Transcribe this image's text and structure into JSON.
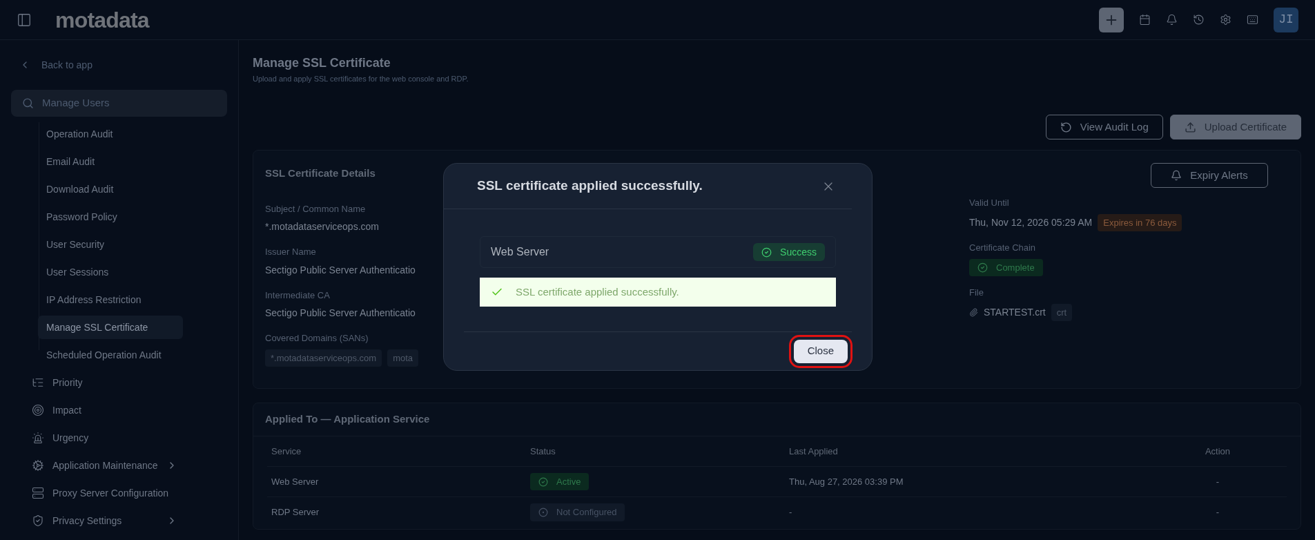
{
  "header": {
    "logo": "motadata",
    "avatar": "JI"
  },
  "sidebar": {
    "back": "Back to app",
    "search": {
      "value": "Manage Users"
    },
    "items": [
      {
        "label": "Operation Audit",
        "kind": "sub",
        "selected": false
      },
      {
        "label": "Email Audit",
        "kind": "sub",
        "selected": false
      },
      {
        "label": "Download Audit",
        "kind": "sub",
        "selected": false
      },
      {
        "label": "Password Policy",
        "kind": "sub",
        "selected": false
      },
      {
        "label": "User Security",
        "kind": "sub",
        "selected": false
      },
      {
        "label": "User Sessions",
        "kind": "sub",
        "selected": false
      },
      {
        "label": "IP Address Restriction",
        "kind": "sub",
        "selected": false
      },
      {
        "label": "Manage SSL Certificate",
        "kind": "sub",
        "selected": true
      },
      {
        "label": "Scheduled Operation Audit",
        "kind": "sub",
        "selected": false
      },
      {
        "label": "Priority",
        "kind": "priority",
        "selected": false
      },
      {
        "label": "Impact",
        "kind": "impact",
        "selected": false
      },
      {
        "label": "Urgency",
        "kind": "urgency",
        "selected": false
      },
      {
        "label": "Application Maintenance",
        "kind": "maintenance",
        "selected": false,
        "expandable": true
      },
      {
        "label": "Proxy Server Configuration",
        "kind": "proxy",
        "selected": false
      },
      {
        "label": "Privacy Settings",
        "kind": "privacy",
        "selected": false,
        "expandable": true
      }
    ]
  },
  "page": {
    "title": "Manage SSL Certificate",
    "subtitle": "Upload and apply SSL certificates for the web console and RDP.",
    "buttons": [
      {
        "label": "View Audit Log",
        "kind": "audit"
      },
      {
        "label": "Upload Certificate",
        "kind": "upload"
      }
    ]
  },
  "details": {
    "title": "SSL Certificate Details",
    "alerts_button": "Expiry Alerts",
    "left": [
      {
        "label": "Subject / Common Name",
        "value": "*.motadataserviceops.com"
      },
      {
        "label": "Issuer Name",
        "value": "Sectigo Public Server Authenticatio"
      },
      {
        "label": "Intermediate CA",
        "value": "Sectigo Public Server Authenticatio"
      }
    ],
    "sans_label": "Covered Domains (SANs)",
    "sans": [
      "*.motadataserviceops.com",
      "mota"
    ],
    "valid_until": {
      "label": "Valid Until",
      "value": "Thu, Nov 12, 2026 05:29 AM",
      "badge": "Expires in 76 days"
    },
    "chain": {
      "label": "Certificate Chain",
      "badge": "Complete"
    },
    "file": {
      "label": "File",
      "name": "STARTEST.crt",
      "ext": "crt"
    }
  },
  "applied": {
    "title": "Applied To — Application Service",
    "columns": [
      "Service",
      "Status",
      "Last Applied",
      "Action"
    ],
    "rows": [
      {
        "service": "Web Server",
        "status": "Active",
        "kind": "active",
        "last": "Thu, Aug 27, 2026 03:39 PM",
        "action": "-"
      },
      {
        "service": "RDP Server",
        "status": "Not Configured",
        "kind": "none",
        "last": "-",
        "action": "-"
      }
    ]
  },
  "dialog": {
    "title": "SSL certificate applied successfully.",
    "result": {
      "name": "Web Server",
      "status": "Success"
    },
    "banner": "SSL certificate applied successfully.",
    "close_button": {
      "label": "Close",
      "highlighted": true
    }
  }
}
